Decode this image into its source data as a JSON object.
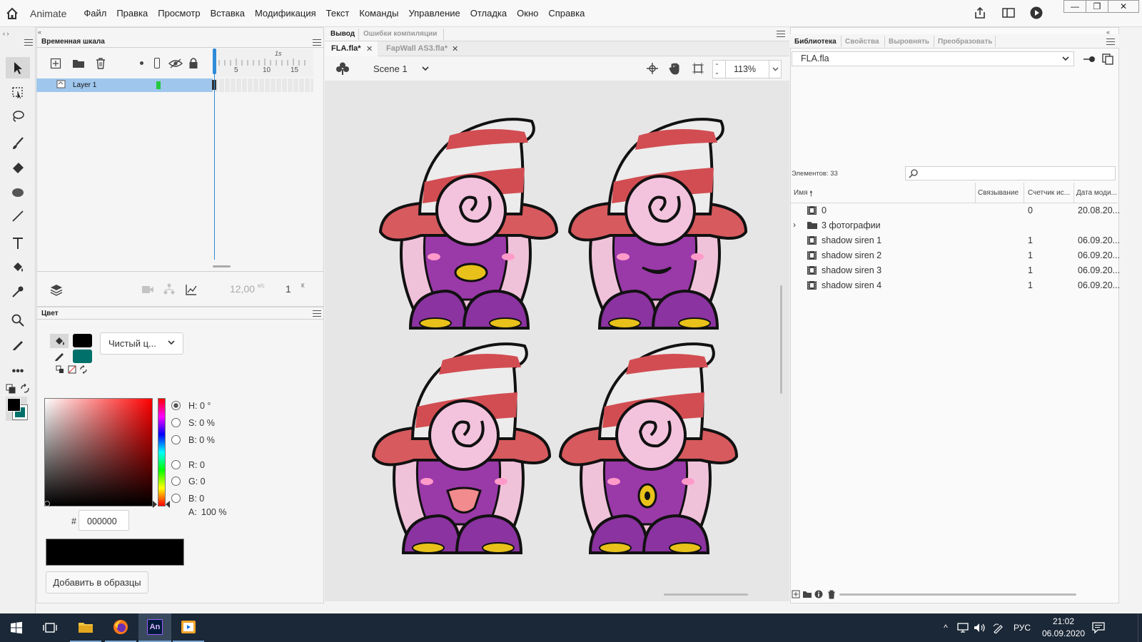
{
  "app": {
    "name": "Animate"
  },
  "menu": [
    "Файл",
    "Правка",
    "Просмотр",
    "Вставка",
    "Модификация",
    "Текст",
    "Команды",
    "Управление",
    "Отладка",
    "Окно",
    "Справка"
  ],
  "window_controls": {
    "minimize": "—",
    "restore": "❐",
    "close": "✕"
  },
  "timeline": {
    "tab": "Временная шкала",
    "layer_name": "Layer 1",
    "ruler": [
      "1s",
      "5",
      "10",
      "15"
    ],
    "fps": "12,00",
    "fps_unit": "к/с",
    "frame": "1",
    "frame_unit": "К"
  },
  "color_panel": {
    "tab": "Цвет",
    "fill_type": "Чистый ц...",
    "H": "H: 0 °",
    "S": "S: 0 %",
    "B": "B: 0 %",
    "R": "R: 0",
    "G": "G: 0",
    "Bv": "B: 0",
    "A_label": "A:",
    "A_value": "100 %",
    "hex_label": "#",
    "hex": "000000",
    "add_button": "Добавить в образцы",
    "stroke_color": "#000000",
    "fill_color": "#00706b"
  },
  "output_tabs": {
    "active": "Вывод",
    "other": "Ошибки компиляции"
  },
  "doc_tabs": [
    {
      "label": "FLA.fla*",
      "active": true
    },
    {
      "label": "FapWall AS3.fla*",
      "active": false
    }
  ],
  "stage_bar": {
    "scene": "Scene 1",
    "zoom": "113%"
  },
  "library": {
    "tabs": [
      "Библиотека",
      "Свойства",
      "Выровнять",
      "Преобразовать"
    ],
    "file": "FLA.fla",
    "items_count": "Элементов: 33",
    "columns": [
      "Имя",
      "Связывание",
      "Счетчик ис...",
      "Дата моди..."
    ],
    "rows": [
      {
        "name": "0",
        "count": "0",
        "date": "20.08.20...",
        "folder": false
      },
      {
        "name": "3 фотографии",
        "count": "",
        "date": "",
        "folder": true
      },
      {
        "name": "shadow siren 1",
        "count": "1",
        "date": "06.09.20...",
        "folder": false
      },
      {
        "name": "shadow siren 2",
        "count": "1",
        "date": "06.09.20...",
        "folder": false
      },
      {
        "name": "shadow siren 3",
        "count": "1",
        "date": "06.09.20...",
        "folder": false
      },
      {
        "name": "shadow siren 4",
        "count": "1",
        "date": "06.09.20...",
        "folder": false
      }
    ]
  },
  "taskbar": {
    "lang": "РУС",
    "time": "21:02",
    "date": "06.09.2020",
    "an_label": "An"
  },
  "colors": {
    "selection": "#9fc6ec",
    "accent": "#2f8bd8",
    "taskbar": "#1b2837"
  }
}
